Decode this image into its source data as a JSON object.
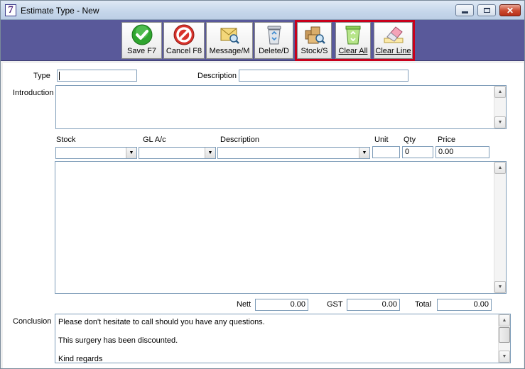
{
  "window": {
    "title": "Estimate Type - New",
    "app_icon_glyph": "7"
  },
  "toolbar": {
    "save": "Save F7",
    "cancel": "Cancel F8",
    "message": "Message/M",
    "delete": "Delete/D",
    "stock": "Stock/S",
    "clear_all": "Clear All",
    "clear_line": "Clear Line"
  },
  "form": {
    "type_label": "Type",
    "type_value": "",
    "description_label": "Description",
    "description_value": "",
    "introduction_label": "Introduction",
    "introduction_value": ""
  },
  "lines": {
    "stock_label": "Stock",
    "gl_label": "GL A/c",
    "description_label": "Description",
    "unit_label": "Unit",
    "qty_label": "Qty",
    "price_label": "Price",
    "stock_value": "",
    "gl_value": "",
    "description_value": "",
    "unit_value": "",
    "qty_value": "0",
    "price_value": "0.00",
    "rows": []
  },
  "totals": {
    "nett_label": "Nett",
    "nett_value": "0.00",
    "gst_label": "GST",
    "gst_value": "0.00",
    "total_label": "Total",
    "total_value": "0.00"
  },
  "conclusion": {
    "label": "Conclusion",
    "lines": [
      "Please don't hesitate to call should you have any questions.",
      "This surgery has been discounted.",
      "Kind regards"
    ]
  },
  "colors": {
    "toolbar_bg": "#59599a",
    "highlight_box": "#c8001c"
  }
}
